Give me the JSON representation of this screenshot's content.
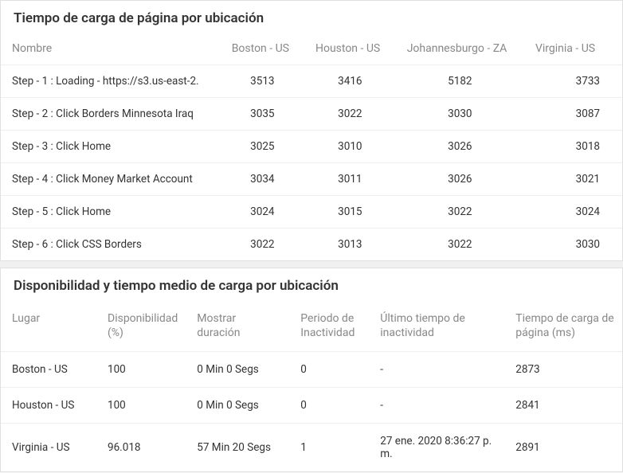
{
  "table1": {
    "title": "Tiempo de carga de página por ubicación",
    "headers": [
      "Nombre",
      "Boston - US",
      "Houston - US",
      "Johannesburgo - ZA",
      "Virginia - US"
    ],
    "rows": [
      {
        "name": "Step - 1 : Loading - https://s3.us-east-2.",
        "v": [
          "3513",
          "3416",
          "5182",
          "3733"
        ]
      },
      {
        "name": "Step - 2 : Click Borders Minnesota Iraq",
        "v": [
          "3035",
          "3022",
          "3030",
          "3087"
        ]
      },
      {
        "name": "Step - 3 : Click Home",
        "v": [
          "3025",
          "3010",
          "3026",
          "3018"
        ]
      },
      {
        "name": "Step - 4 : Click Money Market Account",
        "v": [
          "3034",
          "3011",
          "3026",
          "3021"
        ]
      },
      {
        "name": "Step - 5 : Click Home",
        "v": [
          "3024",
          "3015",
          "3022",
          "3024"
        ]
      },
      {
        "name": "Step - 6 : Click CSS Borders",
        "v": [
          "3022",
          "3013",
          "3022",
          "3030"
        ]
      }
    ]
  },
  "table2": {
    "title": "Disponibilidad y tiempo medio de carga por ubicación",
    "headers": [
      "Lugar",
      "Disponibilidad (%)",
      "Mostrar duración",
      "Periodo de Inactividad",
      "Último tiempo de inactividad",
      "Tiempo de carga de página (ms)"
    ],
    "rows": [
      {
        "c": [
          "Boston - US",
          "100",
          "0 Min 0 Segs",
          "0",
          "-",
          "2873"
        ]
      },
      {
        "c": [
          "Houston - US",
          "100",
          "0 Min 0 Segs",
          "0",
          "-",
          "2841"
        ]
      },
      {
        "c": [
          "Virginia - US",
          "96.018",
          "57 Min 20 Segs",
          "1",
          "27 ene. 2020 8:36:27 p. m.",
          "2891"
        ]
      }
    ]
  }
}
